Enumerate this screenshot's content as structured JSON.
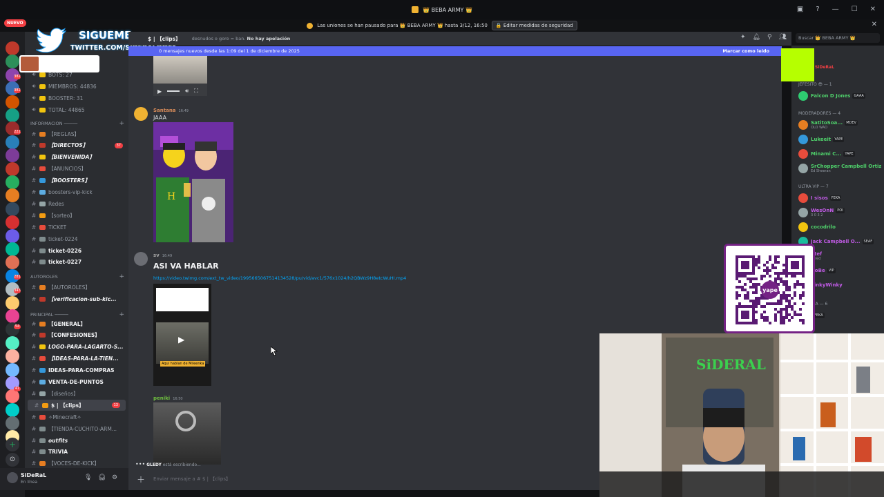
{
  "window": {
    "title": "👑 BEBA ARMY 👑",
    "controls": [
      "—",
      "☐",
      "✕"
    ]
  },
  "badge_new": "NUEVO",
  "notice": {
    "text": "Las uniones se han pausado para 👑 BEBA ARMY 👑 hasta 3/12, 16:50",
    "button": "Editar medidas de seguridad",
    "close": "✕"
  },
  "overlay": {
    "follow": "SIGUEME",
    "handle": "TWITTER.COM/SIDERALDOTA"
  },
  "server_rail": {
    "badges": [
      "382",
      "382",
      "222",
      "281",
      "343",
      "54",
      "41"
    ]
  },
  "sidebar": {
    "stats": [
      {
        "label": "BOTS: 27"
      },
      {
        "label": "MIEMBROS: 44836"
      },
      {
        "label": "BOOSTER: 31"
      },
      {
        "label": "TOTAL: 44865"
      }
    ],
    "cat_info": "INFORMACION ─────",
    "info_channels": [
      {
        "name": "【REGLAS】",
        "style": "normal"
      },
      {
        "name": "【DIRECTOS】",
        "style": "bold",
        "badge": "37"
      },
      {
        "name": "【BIENVENIDA】",
        "style": "bold"
      },
      {
        "name": "【ANUNCIOS】",
        "style": "normal"
      },
      {
        "name": "【BOOSTERS】",
        "style": "bold"
      },
      {
        "name": "boosters-vip-kick",
        "style": "normal"
      },
      {
        "name": "Redes",
        "style": "normal"
      },
      {
        "name": "【sorteo】",
        "style": "normal"
      },
      {
        "name": "TICKET",
        "style": "normal"
      },
      {
        "name": "ticket-0224",
        "style": "normal"
      },
      {
        "name": "ticket-0226",
        "style": "white"
      },
      {
        "name": "ticket-0227",
        "style": "white"
      }
    ],
    "cat_autoroles": "AUTOROLES",
    "autorole_channels": [
      {
        "name": "【AUTOROLES】",
        "style": "normal"
      },
      {
        "name": "【verificacion-sub-kic...",
        "style": "bold"
      }
    ],
    "cat_principal": "PRINCIPAL ─────",
    "principal_channels": [
      {
        "name": "【GENERAL】",
        "style": "white"
      },
      {
        "name": "【CONFESIONES】",
        "style": "white"
      },
      {
        "name": "LOGO-PARA-LAGARTO-S...",
        "style": "bold"
      },
      {
        "name": "【IDEAS-PARA-LA-TIEN...",
        "style": "bold"
      },
      {
        "name": "IDEAS-PARA-COMPRAS",
        "style": "white"
      },
      {
        "name": "VENTA-DE-PUNTOS",
        "style": "white"
      },
      {
        "name": "【diseños】",
        "style": "normal"
      },
      {
        "name": "$ | 【clips】",
        "style": "active",
        "badge": "13"
      },
      {
        "name": "✧Minecraft✧",
        "style": "normal"
      },
      {
        "name": "【TIENDA-CUCHITO-ARM...",
        "style": "normal"
      },
      {
        "name": "outfits",
        "style": "bold"
      },
      {
        "name": "TRIVIA",
        "style": "white"
      },
      {
        "name": "【VOCES-DE-KICK】",
        "style": "normal"
      }
    ]
  },
  "user": {
    "name": "SiDeRaL",
    "status": "En línea"
  },
  "chat_header": {
    "channel": "$ | 【clips】",
    "topic_prefix": "desnudos o gore = ban. ",
    "topic_bold": "No hay apelación"
  },
  "search": {
    "placeholder": "Buscar 👑 BEBA ARMY 👑"
  },
  "new_messages": {
    "text": "0 mensajes nuevos desde las 1:09 del 1 de diciembre de 2025",
    "mark_read": "Marcar como leído"
  },
  "messages": [
    {
      "author": "Santana",
      "time": "16:49",
      "text": "JAAA",
      "color": "#d88c5a"
    },
    {
      "author": "sv",
      "time": "16:49",
      "text": "ASI VA HABLAR",
      "color": "#a5a5a5",
      "link": "https://video.twimg.com/ext_tw_video/1995665067514134528/pu/vid/avc1/576x1024/h2QBWz9H8etcWuHI.mp4",
      "thumb_caption": "Aqui hablan de Mileenka"
    },
    {
      "author": "peniki",
      "time": "16:50",
      "color": "#6fbf3f"
    }
  ],
  "typing": {
    "who": "GLEDY",
    "rest": " está escribiendo..."
  },
  "composer": {
    "placeholder": "Enviar mensaje a # $ | 【clips】"
  },
  "members": {
    "top_name": "SiDeRaL",
    "cat_jefesito": "JEFESITO 😎 — 1",
    "jefesito": [
      {
        "name": "Falcon D Jones",
        "tag": "GAAA",
        "color": "#4fd16b"
      }
    ],
    "cat_mods": "MODERADORES — 4",
    "mods": [
      {
        "name": "SatitoSoa...",
        "tag": "MDEV",
        "sub": "OLO WAO",
        "color": "#4fd16b"
      },
      {
        "name": "Lukeeit",
        "tag": "YAPE",
        "color": "#4fd16b"
      },
      {
        "name": "Minami C...",
        "tag": "YAPE",
        "color": "#4fd16b"
      },
      {
        "name": "SrChopper Campbell Ortiz",
        "sub": "Ed Sheeran",
        "color": "#4fd16b"
      }
    ],
    "cat_ultra": "ULTRA VIP — 7",
    "ultra": [
      {
        "name": "I sisos",
        "tag": "FEKA",
        "color": "#c15be6"
      },
      {
        "name": "WesOnN",
        "tag": "POI",
        "sub": "3 0 3 2",
        "color": "#c15be6"
      },
      {
        "name": "cocodrilo",
        "color": "#4fd16b"
      },
      {
        "name": "Jack Campbell O...",
        "tag": "SEAF",
        "color": "#c15be6"
      },
      {
        "name": "Stef",
        "sub": "bored",
        "color": "#c15be6"
      },
      {
        "name": "DoBe",
        "tag": "VIP",
        "color": "#c15be6"
      },
      {
        "name": "TinkyWinky",
        "color": "#c15be6"
      }
    ],
    "cat_nobleza": "NOBLEZA — 6",
    "nobleza": [
      {
        "name": "",
        "tag": "FEKA",
        "color": "#c15be6"
      }
    ]
  },
  "qr": {
    "brand": "yape"
  },
  "webcam": {
    "sign": "SiDERAL"
  },
  "colors": {
    "accent": "#5865f2",
    "danger": "#f23f43",
    "bg": "#313338",
    "sidebar": "#2b2d31",
    "rail": "#1e1f22",
    "qr_border": "#742284",
    "green": "#b6ff00"
  }
}
